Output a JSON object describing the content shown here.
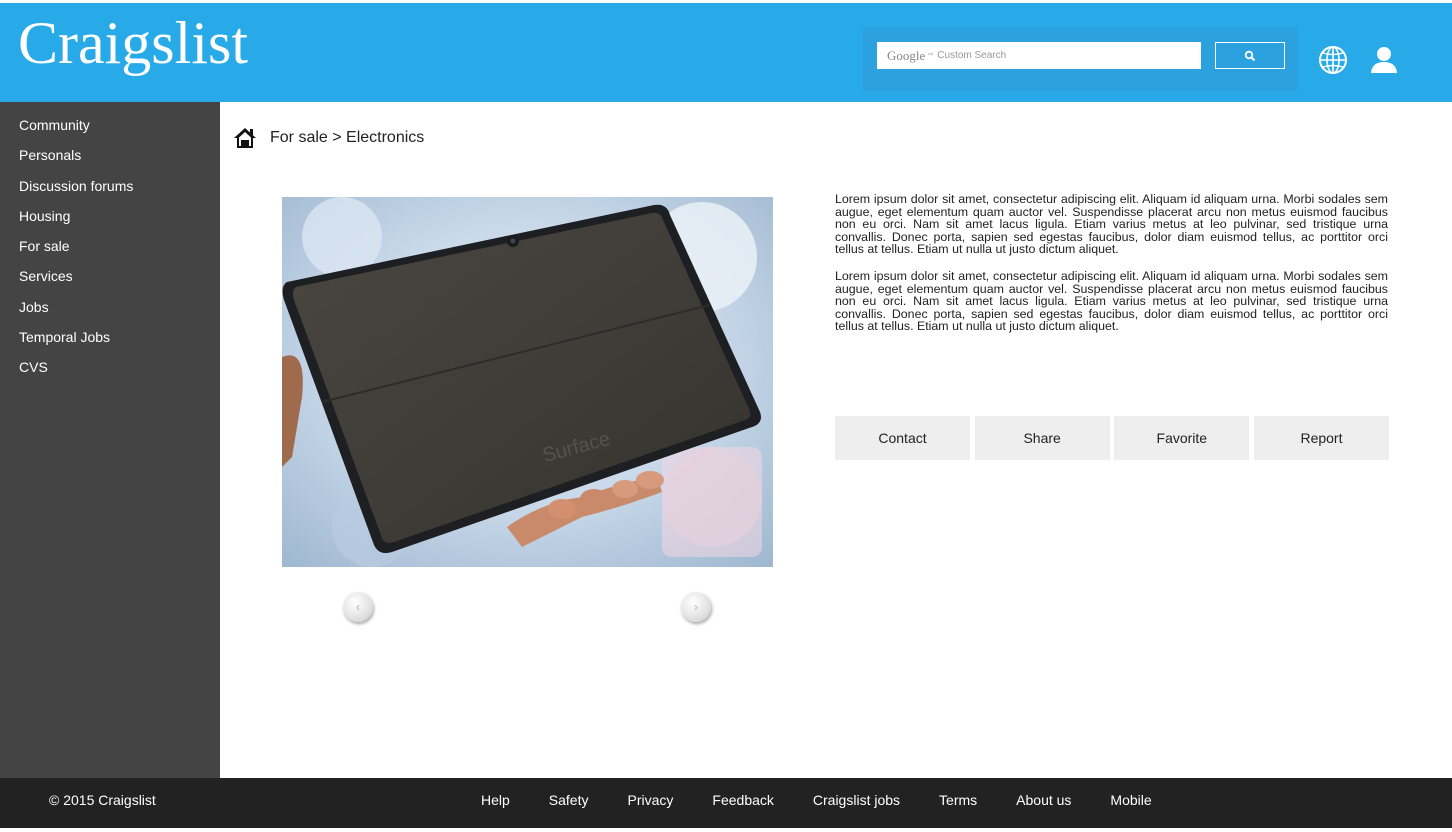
{
  "header": {
    "logo": "Craigslist",
    "search": {
      "brand": "Google",
      "brand_mark": "™",
      "placeholder": "Custom Search"
    },
    "icons": [
      "search-icon",
      "globe-icon",
      "user-icon"
    ]
  },
  "sidebar": {
    "items": [
      {
        "label": "Community"
      },
      {
        "label": "Personals"
      },
      {
        "label": "Discussion forums"
      },
      {
        "label": "Housing"
      },
      {
        "label": "For sale"
      },
      {
        "label": "Services"
      },
      {
        "label": "Jobs"
      },
      {
        "label": "Temporal Jobs"
      },
      {
        "label": "CVS"
      }
    ]
  },
  "breadcrumb": {
    "text": "For sale > Electronics"
  },
  "listing": {
    "photo_brand": "Surface",
    "description": [
      "Lorem ipsum dolor sit amet, consectetur adipiscing elit. Aliquam id aliquam urna. Morbi sodales sem augue, eget elementum quam auctor vel. Suspendisse placerat arcu non metus euismod faucibus non eu orci. Nam sit amet lacus ligula. Etiam varius metus at leo pulvinar, sed tristique urna convallis. Donec porta, sapien sed egestas faucibus, dolor diam euismod tellus, ac porttitor orci tellus at tellus. Etiam ut nulla ut justo dictum aliquet.",
      "Lorem ipsum dolor sit amet, consectetur adipiscing elit. Aliquam id aliquam urna. Morbi sodales sem augue, eget elementum quam auctor vel. Suspendisse placerat arcu non metus euismod faucibus non eu orci. Nam sit amet lacus ligula. Etiam varius metus at leo pulvinar, sed tristique urna convallis. Donec porta, sapien sed egestas faucibus, dolor diam euismod tellus, ac porttitor orci tellus at tellus. Etiam ut nulla ut justo dictum aliquet."
    ],
    "actions": [
      "Contact",
      "Share",
      "Favorite",
      "Report"
    ],
    "gallery": {
      "prev": "‹",
      "next": "›"
    }
  },
  "footer": {
    "copyright": "© 2015 Craigslist",
    "links": [
      "Help",
      "Safety",
      "Privacy",
      "Feedback",
      "Craigslist jobs",
      "Terms",
      "About us",
      "Mobile"
    ]
  },
  "colors": {
    "header_bg": "#29aae8",
    "sidebar_bg": "#444444",
    "footer_bg": "#222222",
    "action_bg": "#eeeeee"
  }
}
